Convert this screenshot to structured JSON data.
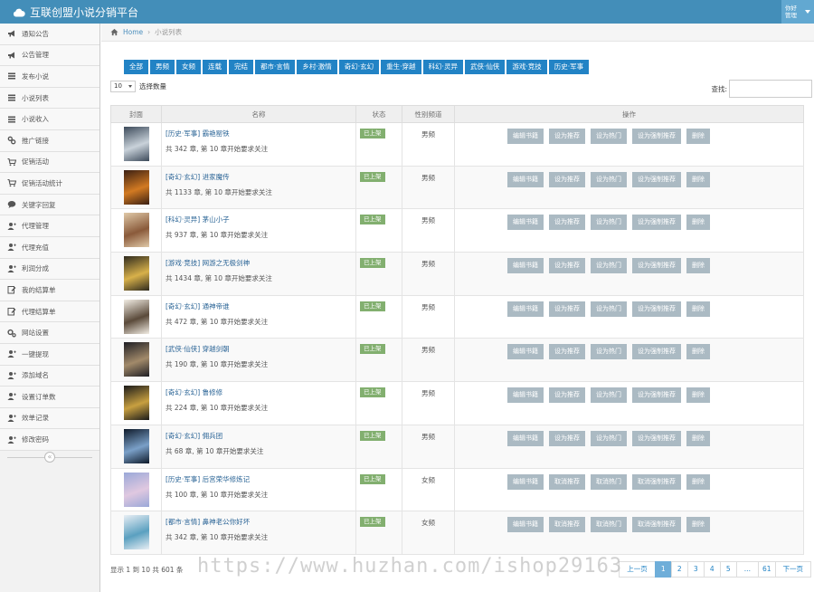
{
  "app": {
    "title": "互联创盟小说分销平台",
    "user_line1": "你好",
    "user_line2": "管理"
  },
  "colors": {
    "topbar": "#438eb9",
    "category_button": "#2283c5",
    "status_badge": "#82af6f",
    "action_button": "#abbac3",
    "active_page": "#6faed9"
  },
  "sidebar": {
    "items": [
      {
        "label": "通知公告",
        "icon": "megaphone-icon"
      },
      {
        "label": "公告管理",
        "icon": "megaphone-icon"
      },
      {
        "label": "发布小说",
        "icon": "list-icon"
      },
      {
        "label": "小说列表",
        "icon": "list-icon"
      },
      {
        "label": "小说收入",
        "icon": "list-icon"
      },
      {
        "label": "推广链接",
        "icon": "link-icon"
      },
      {
        "label": "促销活动",
        "icon": "cart-icon"
      },
      {
        "label": "促销活动统计",
        "icon": "cart-icon"
      },
      {
        "label": "关键字回复",
        "icon": "comment-icon"
      },
      {
        "label": "代理管理",
        "icon": "user-add-icon"
      },
      {
        "label": "代理充值",
        "icon": "user-add-icon"
      },
      {
        "label": "利润分成",
        "icon": "user-add-icon"
      },
      {
        "label": "我的结算单",
        "icon": "edit-icon"
      },
      {
        "label": "代理结算单",
        "icon": "edit-icon"
      },
      {
        "label": "网站设置",
        "icon": "gears-icon"
      },
      {
        "label": "一键提现",
        "icon": "user-add-icon"
      },
      {
        "label": "添加域名",
        "icon": "user-add-icon"
      },
      {
        "label": "设置订单数",
        "icon": "user-add-icon"
      },
      {
        "label": "效单记录",
        "icon": "user-add-icon"
      },
      {
        "label": "修改密码",
        "icon": "user-add-icon"
      }
    ],
    "collapse_glyph": "«"
  },
  "breadcrumb": {
    "home": "Home",
    "separator": "›",
    "current": "小说列表"
  },
  "categories": [
    "全部",
    "男频",
    "女频",
    "连载",
    "完结",
    "都市·言情",
    "乡村·激情",
    "奇幻·玄幻",
    "重生·穿越",
    "科幻·灵异",
    "武侠·仙侠",
    "游戏·竞技",
    "历史·军事"
  ],
  "length_control": {
    "value": "10",
    "label": "选择数量"
  },
  "search": {
    "label": "查找:",
    "value": ""
  },
  "table": {
    "headers": [
      "封面",
      "名称",
      "状态",
      "性别频道",
      "操作"
    ],
    "rows": [
      {
        "title": "[历史·军事] 霸艳罂铁",
        "desc": "共 342 章, 第 10 章开始要求关注",
        "status": "已上架",
        "gender": "男频",
        "actions": [
          "编辑书籍",
          "设为推荐",
          "设为热门",
          "设为强制推荐",
          "删除"
        ],
        "cover_colors": [
          "#3c4a5a",
          "#c9d2da"
        ]
      },
      {
        "title": "[奇幻·玄幻] 进家魔传",
        "desc": "共 1133 章, 第 10 章开始要求关注",
        "status": "已上架",
        "gender": "男频",
        "actions": [
          "编辑书籍",
          "设为推荐",
          "设为热门",
          "设为强制推荐",
          "删除"
        ],
        "cover_colors": [
          "#3a1f12",
          "#d27a22"
        ]
      },
      {
        "title": "[科幻·灵异] 茅山小子",
        "desc": "共 937 章, 第 10 章开始要求关注",
        "status": "已上架",
        "gender": "男频",
        "actions": [
          "编辑书籍",
          "设为推荐",
          "设为热门",
          "设为强制推荐",
          "删除"
        ],
        "cover_colors": [
          "#e0c9a8",
          "#8a5a3a"
        ]
      },
      {
        "title": "[游戏·竞技] 网游之无极剑神",
        "desc": "共 1434 章, 第 10 章开始要求关注",
        "status": "已上架",
        "gender": "男频",
        "actions": [
          "编辑书籍",
          "设为推荐",
          "设为热门",
          "设为强制推荐",
          "删除"
        ],
        "cover_colors": [
          "#2e2a1e",
          "#d8b14a"
        ]
      },
      {
        "title": "[奇幻·玄幻] 通神帝谁",
        "desc": "共 472 章, 第 10 章开始要求关注",
        "status": "已上架",
        "gender": "男频",
        "actions": [
          "编辑书籍",
          "设为推荐",
          "设为热门",
          "设为强制推荐",
          "删除"
        ],
        "cover_colors": [
          "#f2ede4",
          "#5a4a3a"
        ]
      },
      {
        "title": "[武侠·仙侠] 穿越剑朝",
        "desc": "共 190 章, 第 10 章开始要求关注",
        "status": "已上架",
        "gender": "男频",
        "actions": [
          "编辑书籍",
          "设为推荐",
          "设为热门",
          "设为强制推荐",
          "删除"
        ],
        "cover_colors": [
          "#1e1e24",
          "#a28a6a"
        ]
      },
      {
        "title": "[奇幻·玄幻] 鲁修修",
        "desc": "共 224 章, 第 10 章开始要求关注",
        "status": "已上架",
        "gender": "男频",
        "actions": [
          "编辑书籍",
          "设为推荐",
          "设为热门",
          "设为强制推荐",
          "删除"
        ],
        "cover_colors": [
          "#1a1a1a",
          "#c8a040"
        ]
      },
      {
        "title": "[奇幻·玄幻] 佣兵团",
        "desc": "共 68 章, 第 10 章开始要求关注",
        "status": "已上架",
        "gender": "男频",
        "actions": [
          "编辑书籍",
          "设为推荐",
          "设为热门",
          "设为强制推荐",
          "删除"
        ],
        "cover_colors": [
          "#0e1a2a",
          "#7aa0c8"
        ]
      },
      {
        "title": "[历史·军事] 后宫荣华修炼记",
        "desc": "共 100 章, 第 10 章开始要求关注",
        "status": "已上架",
        "gender": "女频",
        "actions": [
          "编辑书籍",
          "取消推荐",
          "取消热门",
          "取消强制推荐",
          "删除"
        ],
        "cover_colors": [
          "#9aa8d8",
          "#e0c8e0"
        ]
      },
      {
        "title": "[都市·言情] 鼻神老公你好坏",
        "desc": "共 342 章, 第 10 章开始要求关注",
        "status": "已上架",
        "gender": "女频",
        "actions": [
          "编辑书籍",
          "取消推荐",
          "取消热门",
          "取消强制推荐",
          "删除"
        ],
        "cover_colors": [
          "#e8eef4",
          "#5aa0c0"
        ]
      }
    ]
  },
  "footer": {
    "info": "显示 1 到 10 共 601 条",
    "pagination": [
      "上一页",
      "1",
      "2",
      "3",
      "4",
      "5",
      "...",
      "61",
      "下一页"
    ],
    "active_page": "1"
  },
  "watermark": "https://www.huzhan.com/ishop29163"
}
